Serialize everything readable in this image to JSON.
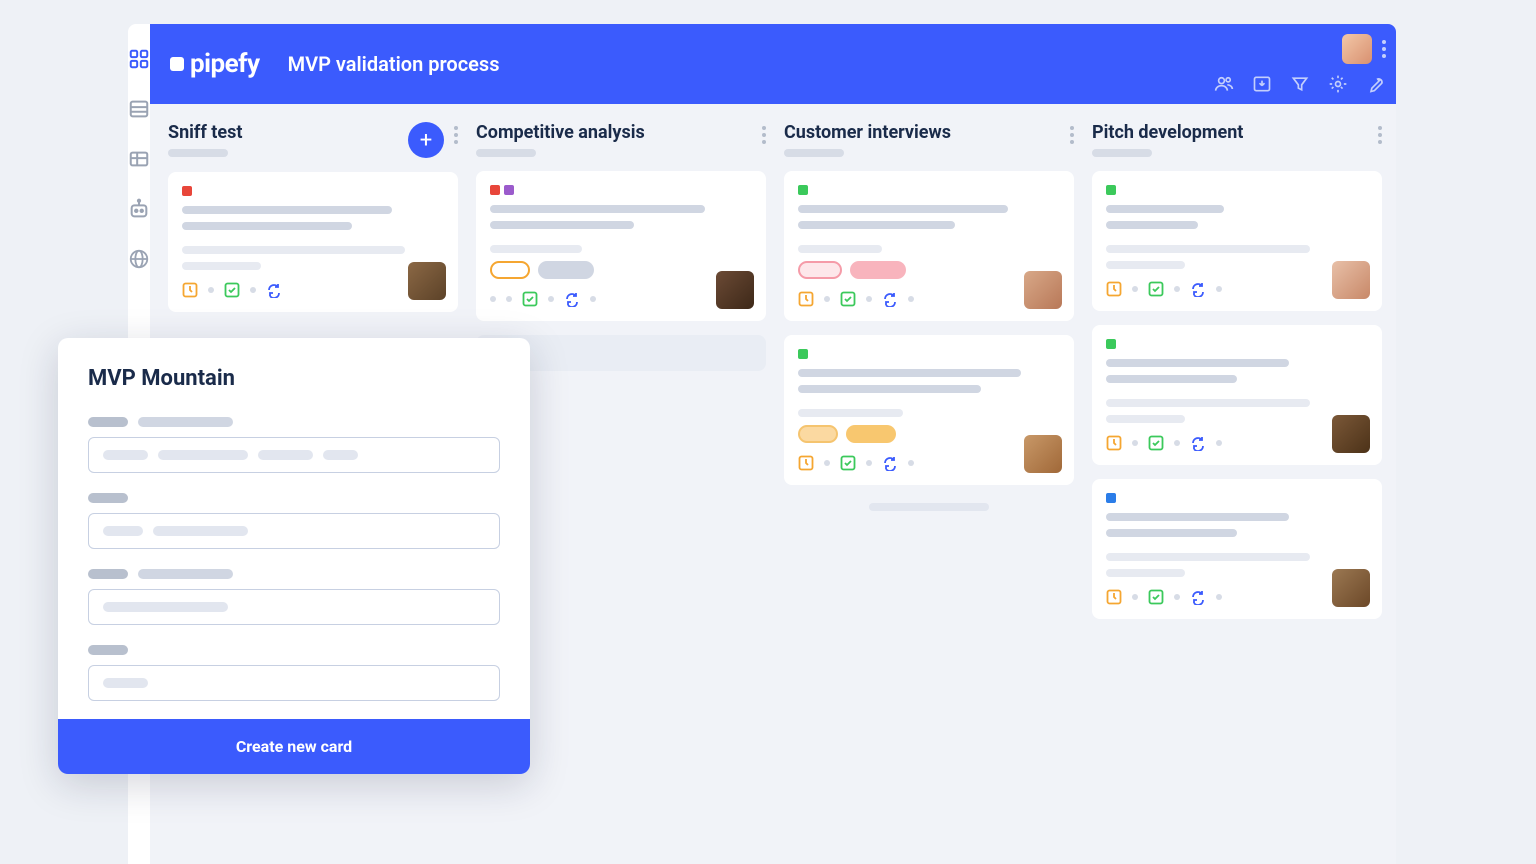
{
  "brand": "pipefy",
  "page_title": "MVP validation process",
  "sidebar": {
    "items": [
      "dashboard-icon",
      "list-icon",
      "table-icon",
      "bot-icon",
      "globe-icon"
    ]
  },
  "header_toolbar": [
    "people-icon",
    "import-icon",
    "filter-icon",
    "settings-icon",
    "wrench-icon"
  ],
  "columns": [
    {
      "title": "Sniff test",
      "has_add": true,
      "cards": [
        {
          "tags": [
            "red"
          ],
          "pills": [],
          "avatar": "user-1"
        }
      ]
    },
    {
      "title": "Competitive analysis",
      "has_add": false,
      "cards": [
        {
          "tags": [
            "red",
            "purple"
          ],
          "pills": [
            "outline-orange",
            "gray"
          ],
          "avatar": "user-2"
        }
      ],
      "ghost": true
    },
    {
      "title": "Customer interviews",
      "has_add": false,
      "cards": [
        {
          "tags": [
            "green"
          ],
          "pills": [
            "outline-pink",
            "fill-pink"
          ],
          "avatar": "user-3"
        },
        {
          "tags": [
            "green"
          ],
          "pills": [
            "fill-orange-light",
            "fill-orange"
          ],
          "avatar": "user-4"
        }
      ],
      "ghost_bar": true
    },
    {
      "title": "Pitch development",
      "has_add": false,
      "cards": [
        {
          "tags": [
            "green"
          ],
          "pills": [],
          "avatar": "user-5"
        },
        {
          "tags": [
            "green"
          ],
          "pills": [],
          "avatar": "user-6"
        },
        {
          "tags": [
            "blue"
          ],
          "pills": [],
          "avatar": "user-7"
        }
      ]
    }
  ],
  "modal": {
    "title": "MVP Mountain",
    "submit_label": "Create new card"
  }
}
